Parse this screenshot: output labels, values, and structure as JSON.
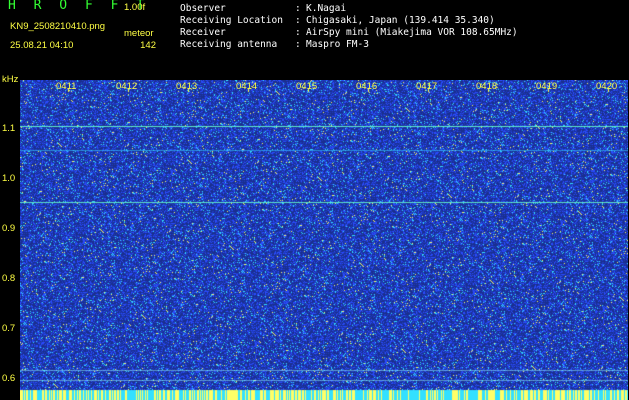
{
  "header": {
    "app_title": "H R O F F T",
    "version": "1.00f",
    "file_name": "KN9_2508210410.png",
    "date_time": "25.08.21 04:10",
    "meteor_label": "meteor",
    "meteor_count": "142"
  },
  "info": [
    {
      "key": "Observer",
      "value": "K.Nagai"
    },
    {
      "key": "Receiving Location",
      "value": "Chigasaki, Japan (139.414 35.340)"
    },
    {
      "key": "Receiver",
      "value": "AirSpy mini (Miakejima VOR 108.65MHz)"
    },
    {
      "key": "Receiving antenna",
      "value": "Maspro FM-3"
    }
  ],
  "separator": ":",
  "plot": {
    "y_unit": "kHz",
    "y_ticks": [
      "1.1",
      "1.0",
      "0.9",
      "0.8",
      "0.7",
      "0.6"
    ],
    "x_ticks": [
      "0411",
      "0412",
      "0413",
      "0414",
      "0415",
      "0416",
      "0417",
      "0418",
      "0419",
      "0420"
    ],
    "colors": {
      "background": "#1a2f8f",
      "noise_blue": "#2a4cff",
      "noise_cyan": "#33e0ff",
      "noise_yellow": "#ffff66",
      "label": "#ffff44",
      "title": "#33ff33"
    }
  }
}
